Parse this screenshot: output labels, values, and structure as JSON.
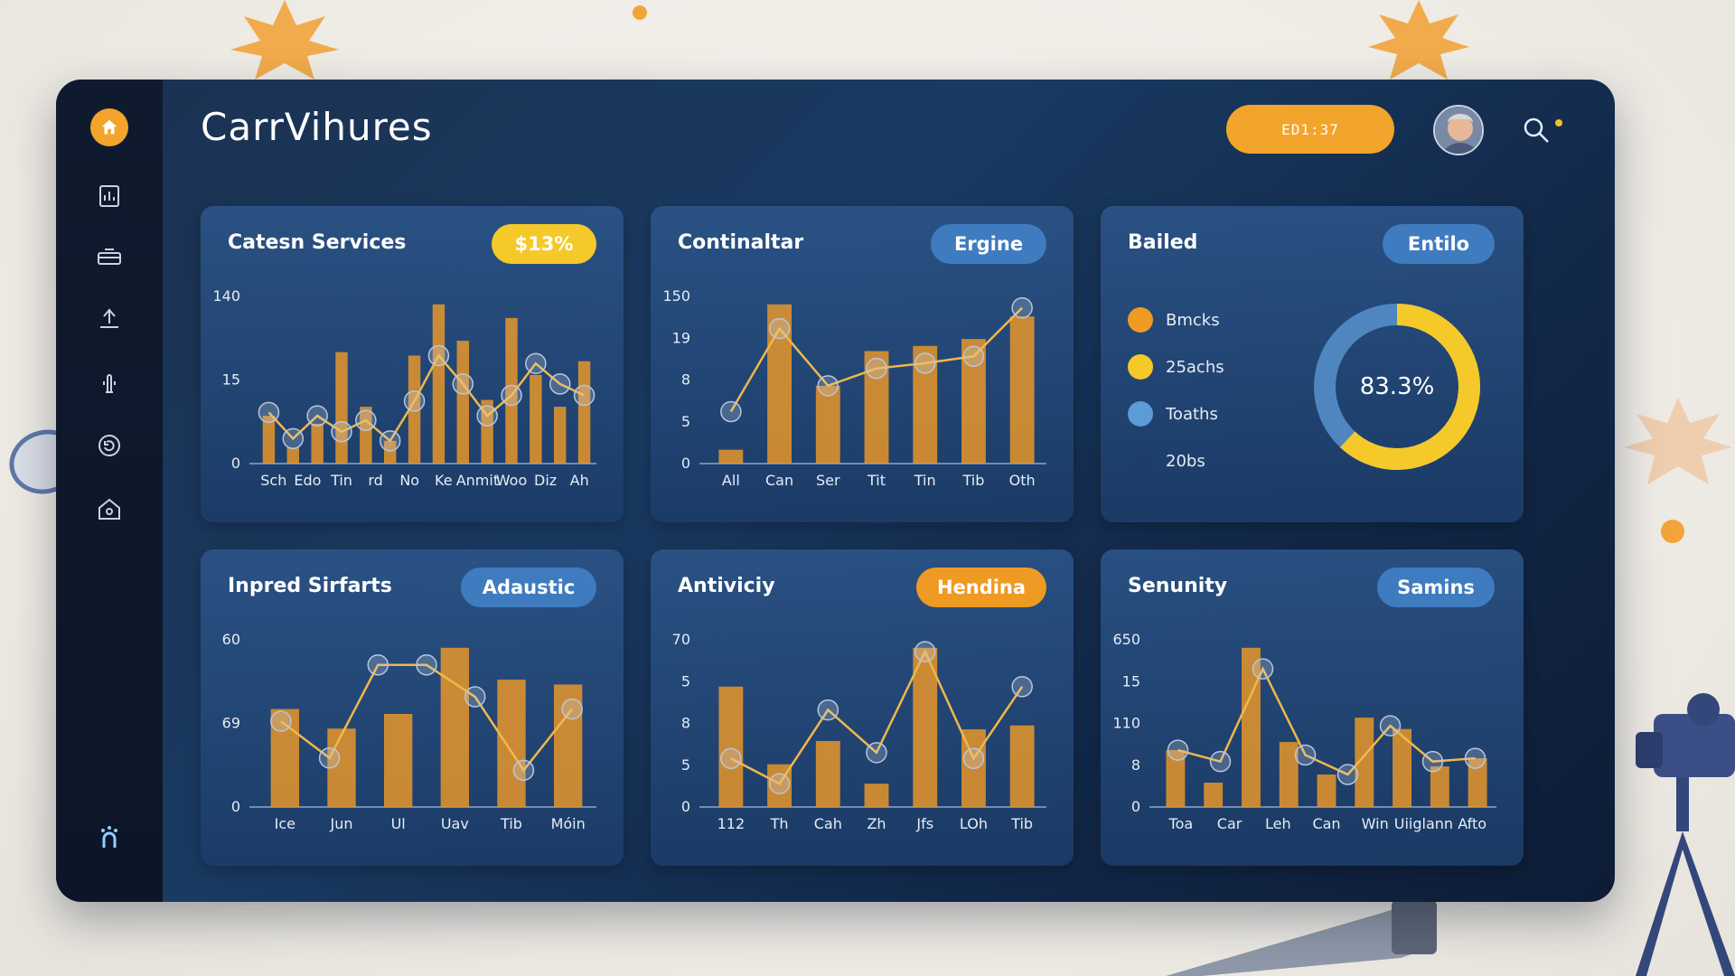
{
  "app": {
    "title": "CarrVihures",
    "top_button": "ED1:37"
  },
  "colors": {
    "accent": "#f2a42b",
    "yellow": "#f5c92a",
    "blue": "#3f7bbf",
    "panel": "#1a3a62"
  },
  "sidebar": {
    "items": [
      {
        "icon": "home-icon"
      },
      {
        "icon": "report-icon"
      },
      {
        "icon": "layers-icon"
      },
      {
        "icon": "upload-icon"
      },
      {
        "icon": "touch-icon"
      },
      {
        "icon": "refresh-icon"
      },
      {
        "icon": "house-icon"
      },
      {
        "icon": "brand-icon"
      }
    ]
  },
  "cards": [
    {
      "title": "Catesn Services",
      "pill": "$13%",
      "pill_color": "yellow",
      "chart_data": {
        "type": "bar+line",
        "y_ticks": [
          "140",
          "15",
          "0"
        ],
        "categories": [
          "Sch",
          "Edo",
          "Tin",
          "rd",
          "No",
          "Ke",
          "Anmit",
          "Woo",
          "Diz",
          "Ah"
        ],
        "bars": [
          42,
          14,
          35,
          98,
          50,
          20,
          95,
          140,
          108,
          56,
          128,
          78,
          50,
          90
        ],
        "line": [
          45,
          22,
          42,
          28,
          38,
          20,
          55,
          95,
          70,
          42,
          60,
          88,
          70,
          60
        ]
      }
    },
    {
      "title": "Continaltar",
      "pill": "Ergine",
      "pill_color": "blue",
      "chart_data": {
        "type": "bar+line",
        "y_ticks": [
          "150",
          "19",
          "8",
          "5",
          "0"
        ],
        "categories": [
          "All",
          "Can",
          "Ser",
          "Tit",
          "Tin",
          "Tib",
          "Oth"
        ],
        "bars": [
          8,
          92,
          45,
          65,
          68,
          72,
          85
        ],
        "line": [
          30,
          78,
          45,
          55,
          58,
          62,
          90
        ]
      }
    },
    {
      "title": "Bailed",
      "pill": "Entilo",
      "pill_color": "blue",
      "donut": {
        "value_label": "83.3%",
        "segments": [
          {
            "label": "Bmcks",
            "color": "#ef9a22"
          },
          {
            "label": "25achs",
            "color": "#f5c92a"
          },
          {
            "label": "Toaths",
            "color": "#5a9bd8"
          },
          {
            "label": "20bs",
            "color": "#1e3e6a"
          }
        ],
        "fill_fraction": 0.62
      }
    },
    {
      "title": "Inpred Sirfarts",
      "pill": "Adaustic",
      "pill_color": "blue",
      "chart_data": {
        "type": "bar+line",
        "y_ticks": [
          "60",
          "69",
          "0"
        ],
        "categories": [
          "Ice",
          "Jun",
          "Ul",
          "Uav",
          "Tib",
          "Móin"
        ],
        "bars": [
          40,
          32,
          38,
          65,
          52,
          50
        ],
        "line": [
          35,
          20,
          58,
          58,
          45,
          15,
          40
        ]
      }
    },
    {
      "title": "Antiviciy",
      "pill": "Hendina",
      "pill_color": "orange",
      "chart_data": {
        "type": "bar+line",
        "y_ticks": [
          "70",
          "5",
          "8",
          "5",
          "0"
        ],
        "categories": [
          "112",
          "Th",
          "Cah",
          "Zh",
          "Jfs",
          "LOh",
          "Tib"
        ],
        "bars": [
          62,
          22,
          34,
          12,
          82,
          40,
          42
        ],
        "line": [
          25,
          12,
          50,
          28,
          80,
          25,
          62
        ]
      }
    },
    {
      "title": "Senunity",
      "pill": "Samins",
      "pill_color": "blue",
      "chart_data": {
        "type": "bar+line",
        "y_ticks": [
          "650",
          "15",
          "110",
          "8",
          "0"
        ],
        "categories": [
          "Toa",
          "Car",
          "Leh",
          "Can",
          "Win",
          "Uiiglann",
          "Afto"
        ],
        "bars": [
          35,
          15,
          98,
          40,
          20,
          55,
          48,
          25,
          30
        ],
        "line": [
          35,
          28,
          85,
          32,
          20,
          50,
          28,
          30
        ]
      }
    }
  ]
}
